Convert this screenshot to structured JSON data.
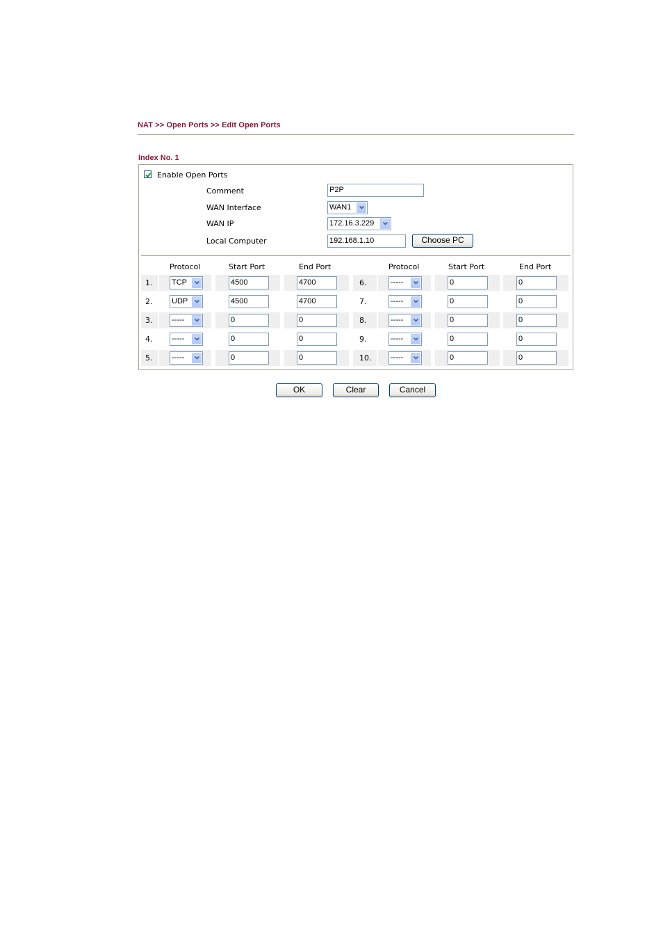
{
  "breadcrumb": "NAT >> Open Ports >> Edit Open Ports",
  "index_label": "Index No. 1",
  "form": {
    "enable": {
      "label": "Enable Open Ports",
      "checked": true
    },
    "comment": {
      "label": "Comment",
      "value": "P2P"
    },
    "wan_interface": {
      "label": "WAN Interface",
      "value": "WAN1"
    },
    "wan_ip": {
      "label": "WAN IP",
      "value": "172.16.3.229"
    },
    "local_computer": {
      "label": "Local Computer",
      "value": "192.168.1.10",
      "button": "Choose PC"
    }
  },
  "table": {
    "headers": [
      "Protocol",
      "Start Port",
      "End Port",
      "Protocol",
      "Start Port",
      "End Port"
    ],
    "rows": [
      {
        "no": "1.",
        "protocol": "TCP",
        "start": "4500",
        "end": "4700"
      },
      {
        "no": "2.",
        "protocol": "UDP",
        "start": "4500",
        "end": "4700"
      },
      {
        "no": "3.",
        "protocol": "-----",
        "start": "0",
        "end": "0"
      },
      {
        "no": "4.",
        "protocol": "-----",
        "start": "0",
        "end": "0"
      },
      {
        "no": "5.",
        "protocol": "-----",
        "start": "0",
        "end": "0"
      },
      {
        "no": "6.",
        "protocol": "-----",
        "start": "0",
        "end": "0"
      },
      {
        "no": "7.",
        "protocol": "-----",
        "start": "0",
        "end": "0"
      },
      {
        "no": "8.",
        "protocol": "-----",
        "start": "0",
        "end": "0"
      },
      {
        "no": "9.",
        "protocol": "-----",
        "start": "0",
        "end": "0"
      },
      {
        "no": "10.",
        "protocol": "-----",
        "start": "0",
        "end": "0"
      }
    ]
  },
  "buttons": {
    "ok": "OK",
    "clear": "Clear",
    "cancel": "Cancel"
  },
  "colors": {
    "title": "#8b1538",
    "row_shade": "#efefef",
    "input_border": "#7f9db9",
    "panel_border": "#a7a496"
  }
}
